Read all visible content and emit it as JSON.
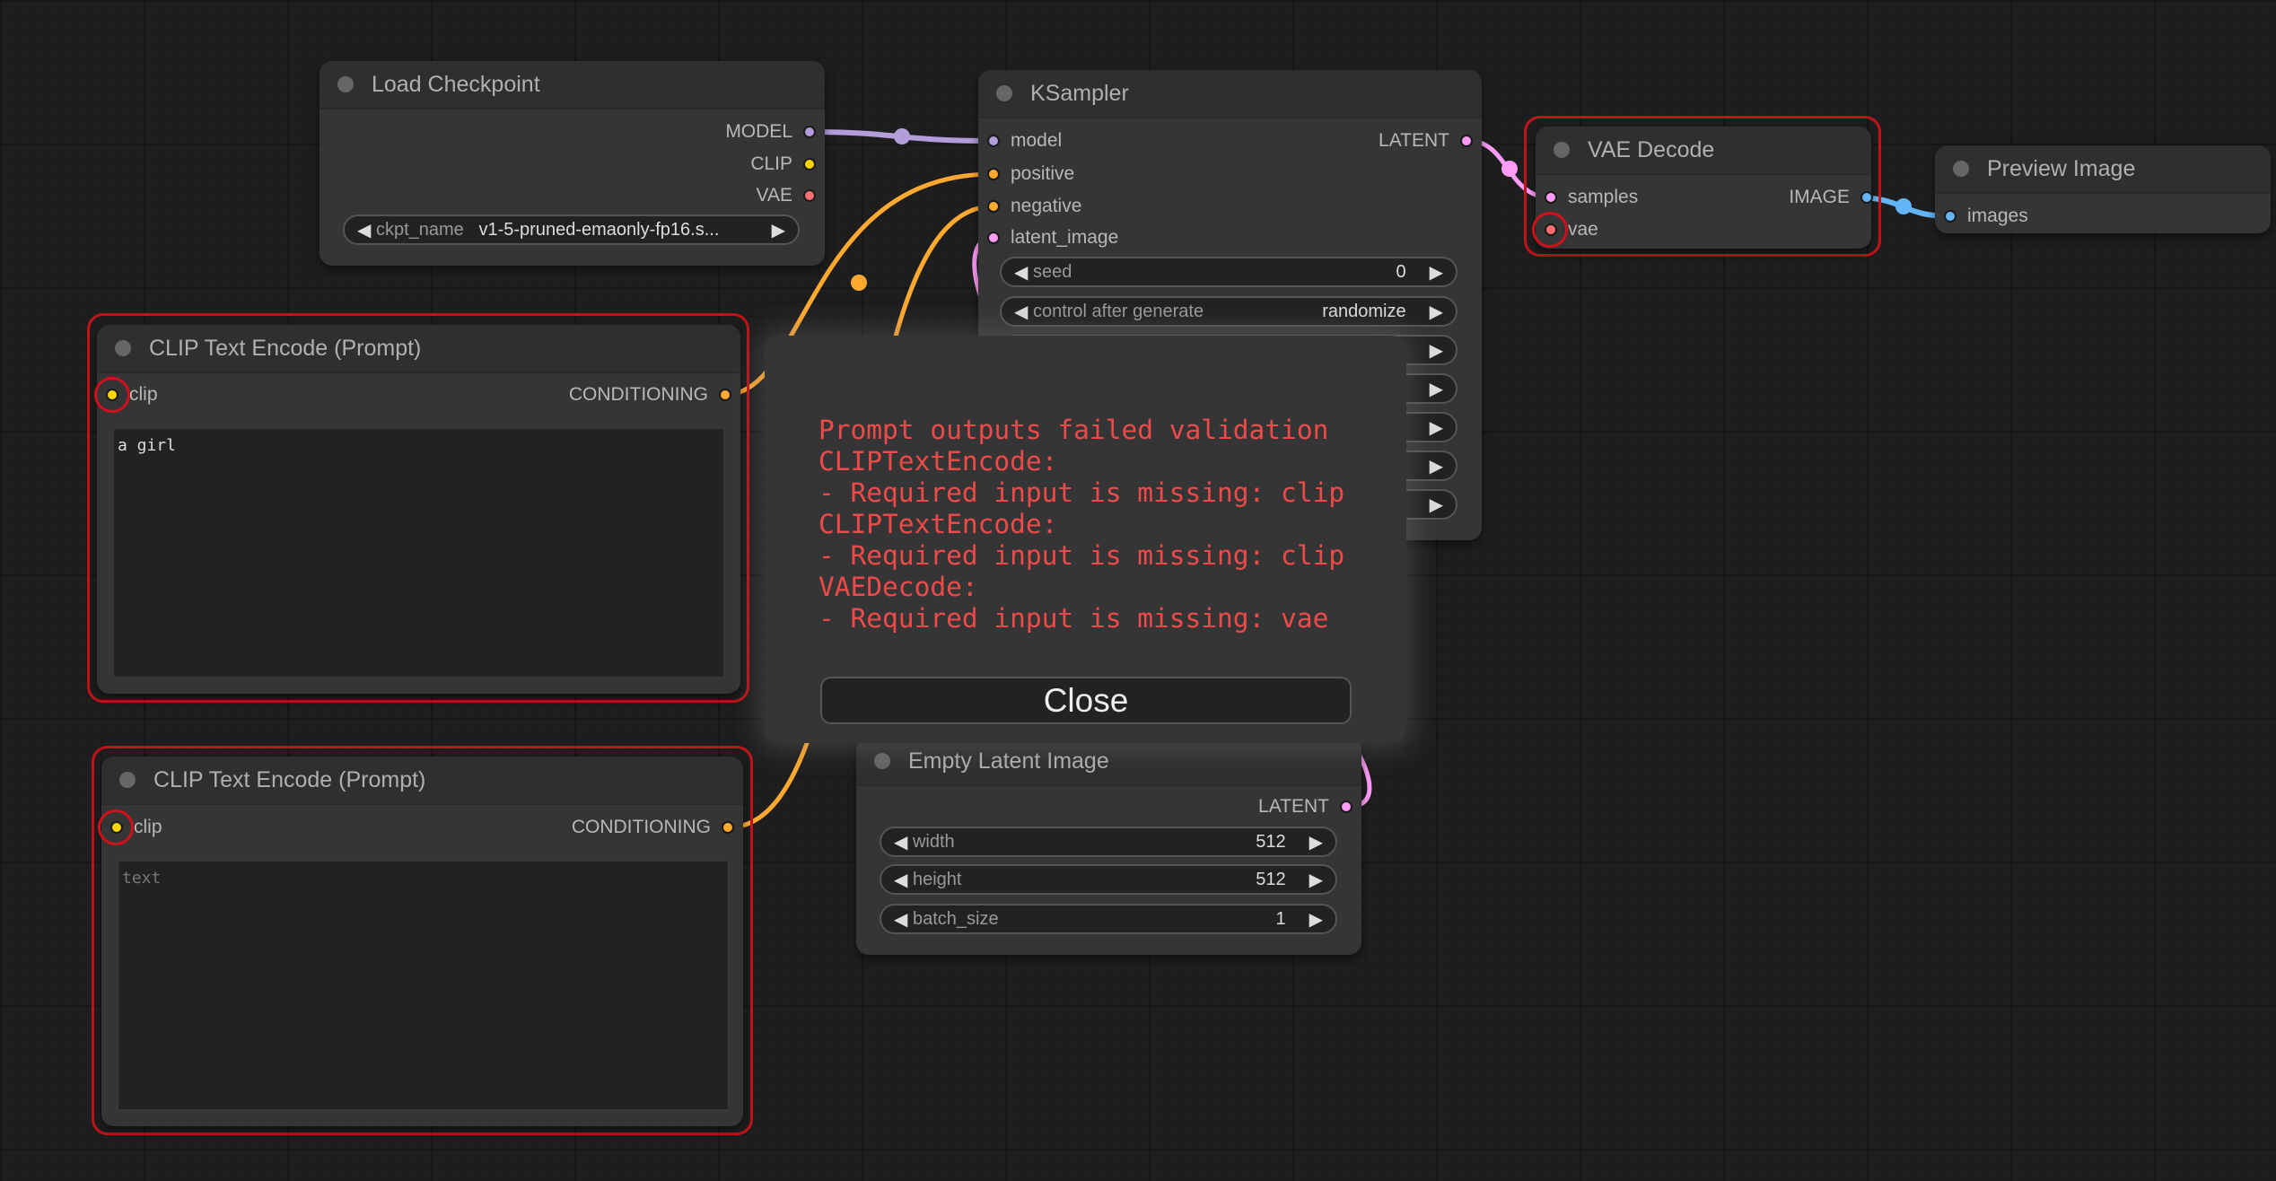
{
  "colors": {
    "model": "#b39ddb",
    "clip": "#ffd500",
    "vae": "#ff6e6e",
    "conditioning": "#ffa931",
    "latent": "#ff9cf9",
    "image": "#64b5f6",
    "error": "#ef4a4a",
    "outline": "#c0141a"
  },
  "load_checkpoint": {
    "title": "Load Checkpoint",
    "outputs": [
      "MODEL",
      "CLIP",
      "VAE"
    ],
    "widget": {
      "label": "ckpt_name",
      "value": "v1-5-pruned-emaonly-fp16.s..."
    }
  },
  "ksampler": {
    "title": "KSampler",
    "inputs": [
      "model",
      "positive",
      "negative",
      "latent_image"
    ],
    "output": "LATENT",
    "widgets": [
      {
        "label": "seed",
        "value": "0"
      },
      {
        "label": "control after generate",
        "value": "randomize"
      }
    ]
  },
  "vae_decode": {
    "title": "VAE Decode",
    "inputs": [
      "samples",
      "vae"
    ],
    "output": "IMAGE"
  },
  "preview_image": {
    "title": "Preview Image",
    "inputs": [
      "images"
    ]
  },
  "clip_text_1": {
    "title": "CLIP Text Encode (Prompt)",
    "input": "clip",
    "output": "CONDITIONING",
    "text": "a girl"
  },
  "clip_text_2": {
    "title": "CLIP Text Encode (Prompt)",
    "input": "clip",
    "output": "CONDITIONING",
    "placeholder": "text"
  },
  "empty_latent": {
    "title": "Empty Latent Image",
    "output": "LATENT",
    "widgets": [
      {
        "label": "width",
        "value": "512"
      },
      {
        "label": "height",
        "value": "512"
      },
      {
        "label": "batch_size",
        "value": "1"
      }
    ]
  },
  "dialog": {
    "message": "Prompt outputs failed validation\nCLIPTextEncode:\n- Required input is missing: clip\nCLIPTextEncode:\n- Required input is missing: clip\nVAEDecode:\n- Required input is missing: vae",
    "close_label": "Close"
  }
}
